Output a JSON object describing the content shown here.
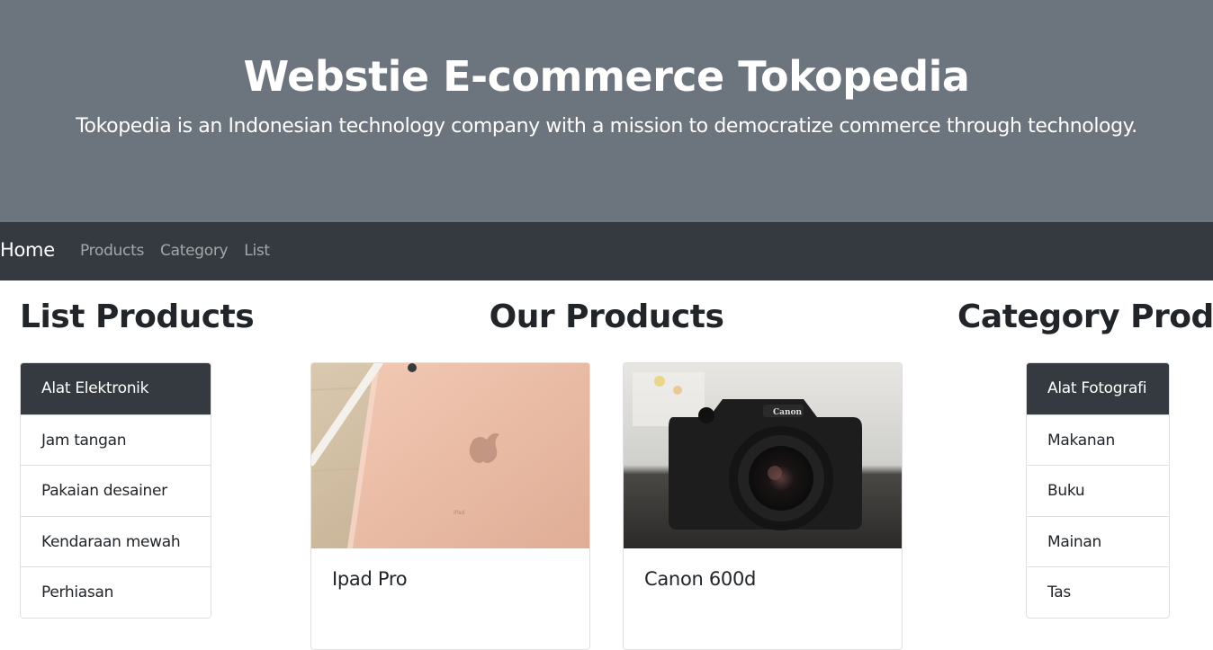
{
  "hero": {
    "title": "Webstie E-commerce Tokopedia",
    "subtitle": "Tokopedia is an Indonesian technology company with a mission to democratize commerce through technology."
  },
  "navbar": {
    "brand": "Home",
    "links": [
      "Products",
      "Category",
      "List"
    ]
  },
  "sections": {
    "list_title": "List Products",
    "products_title": "Our Products",
    "category_title": "Category Product"
  },
  "list_products": {
    "items": [
      {
        "label": "Alat Elektronik",
        "active": true
      },
      {
        "label": "Jam tangan",
        "active": false
      },
      {
        "label": "Pakaian desainer",
        "active": false
      },
      {
        "label": "Kendaraan mewah",
        "active": false
      },
      {
        "label": "Perhiasan",
        "active": false
      }
    ]
  },
  "products": [
    {
      "name": "Ipad Pro",
      "image": "ipad-photo",
      "image_text": "iPad"
    },
    {
      "name": "Canon 600d",
      "image": "canon-camera-photo",
      "image_text": "Canon"
    }
  ],
  "category_products": {
    "items": [
      {
        "label": "Alat Fotografi",
        "active": true
      },
      {
        "label": "Makanan",
        "active": false
      },
      {
        "label": "Buku",
        "active": false
      },
      {
        "label": "Mainan",
        "active": false
      },
      {
        "label": "Tas",
        "active": false
      }
    ]
  },
  "colors": {
    "hero_bg": "#6c757d",
    "navbar_bg": "#343a40",
    "active_item_bg": "#343a40"
  }
}
